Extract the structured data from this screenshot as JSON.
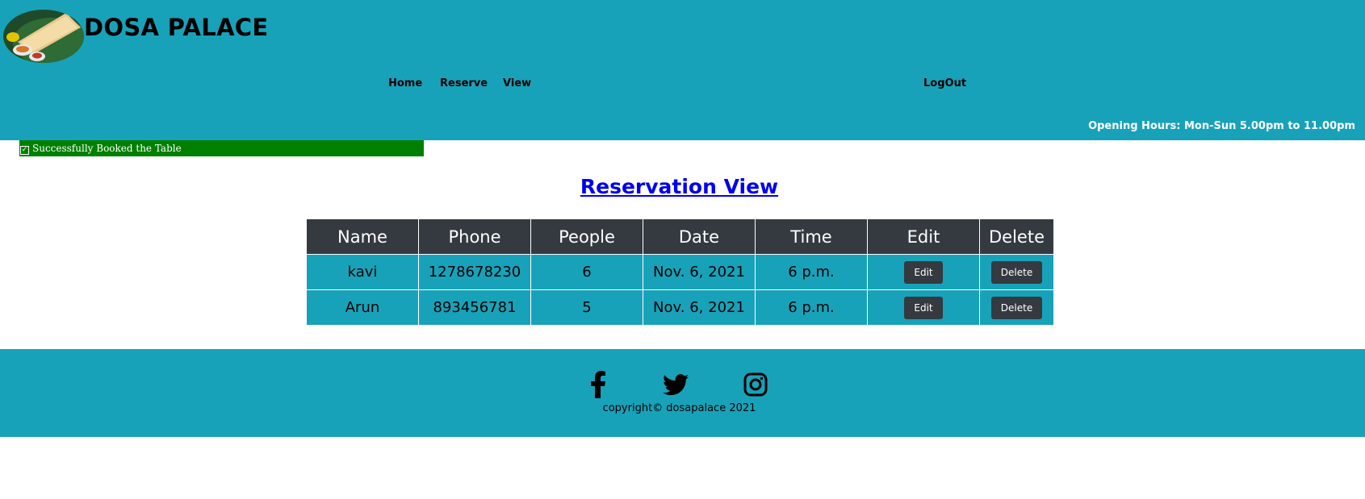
{
  "header": {
    "brand": "DOSA PALACE",
    "nav": {
      "home": "Home",
      "reserve": "Reserve",
      "view": "View",
      "logout": "LogOut"
    },
    "hours": "Opening Hours: Mon-Sun 5.00pm to 11.00pm"
  },
  "alert": {
    "message": "Successfully Booked the Table",
    "color": "#008000"
  },
  "main": {
    "title": "Reservation View",
    "table": {
      "columns": [
        "Name",
        "Phone",
        "People",
        "Date",
        "Time",
        "Edit",
        "Delete"
      ],
      "rows": [
        {
          "name": "kavi",
          "phone": "1278678230",
          "people": "6",
          "date": "Nov. 6, 2021",
          "time": "6 p.m.",
          "edit": "Edit",
          "delete": "Delete"
        },
        {
          "name": "Arun",
          "phone": "893456781",
          "people": "5",
          "date": "Nov. 6, 2021",
          "time": "6 p.m.",
          "edit": "Edit",
          "delete": "Delete"
        }
      ]
    }
  },
  "footer": {
    "social_icons": [
      "facebook-icon",
      "twitter-icon",
      "instagram-icon"
    ],
    "copyright": "copyright© dosapalace 2021"
  },
  "colors": {
    "accent": "#18a2b9",
    "dark": "#343a40",
    "link": "#0000ee",
    "success": "#008000"
  }
}
